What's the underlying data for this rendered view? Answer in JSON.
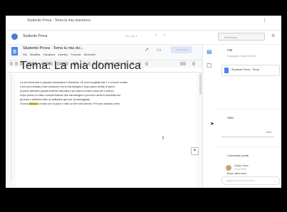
{
  "topbar": {
    "title": "Studente Prova · Tema la mia domenica",
    "menu_icon": "more-vert-icon"
  },
  "classroom": {
    "student_name": "Studente Prova",
    "meta": "Più voti ▾",
    "consegna_label": "Restituisci",
    "help_icon": "settings-icon"
  },
  "doc": {
    "title": "Studente Prova · Tema la mia do...",
    "menu": [
      "File",
      "Modifica",
      "Visualizza",
      "Inserisci",
      "Formato",
      "Strumenti"
    ],
    "share_label": "Condividi",
    "heading": "Tema: La mia domenica",
    "paragraph": [
      "La mia domenica è passata velocissima e divertente. Mi sono svegliata alle 7 e mi sono vestita,",
      "e poi sono andata a fare colazione con la mia famiglia e dopo siamo andati al parco.",
      "Al parco abbiamo giocato insieme alla palla e poi siamo tornati a casa per il pranzo, ",
      "Dopo pranzo ho fatto i compiti insieme alla mia famiglia e poi sono uscita in bicicletta con",
      "gli amici e abbiamo fatto un bellissimo giro per la passeggiata.",
      "Di sera "
    ],
    "highlight": "abbiamo",
    "paragraph_tail": " cenato con la pizza e visto un film tutti insieme. Poi sono andata a letto."
  },
  "panel": {
    "files_title": "File",
    "files_sub": "Consegnato in data 10/12/20",
    "file_name": "Studente Prova · Tema",
    "grade_title": "Voto",
    "grade_value": "/100",
    "comments_title": "Commenti privati",
    "commenter": "Claudio Rossi",
    "commenter_sub": "10 dic 2020",
    "comment_text": "Brava, ottimo tema",
    "comment_placeholder": "Aggiungi commento privato..."
  }
}
